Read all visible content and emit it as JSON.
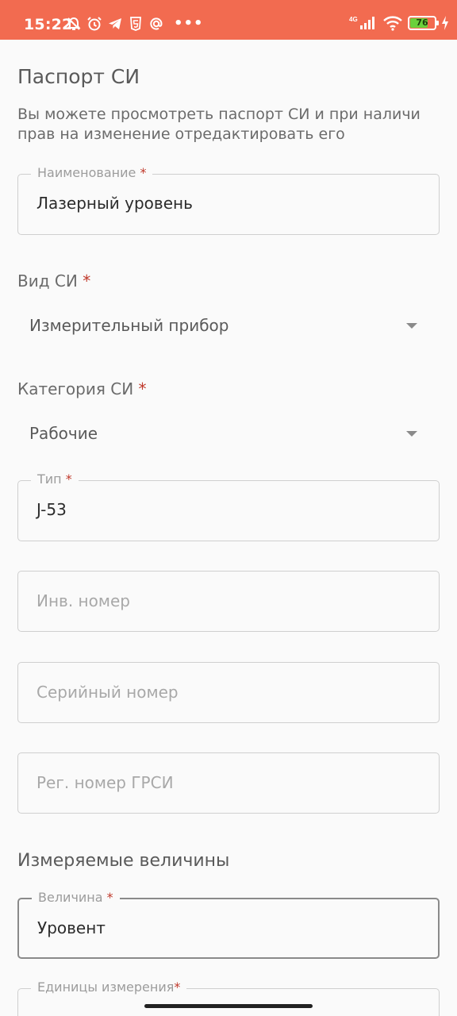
{
  "status_bar": {
    "time": "15:22",
    "network": "4G",
    "battery_level": 76,
    "battery_text": "76",
    "dots": "•••"
  },
  "header": {
    "title": "Паспорт СИ",
    "description": "Вы можете просмотреть паспорт СИ и при наличи прав на изменение отредактировать его"
  },
  "fields": {
    "name": {
      "label": "Наименование",
      "required_mark": "*",
      "value": "Лазерный уровень"
    },
    "vid": {
      "label": "Вид СИ",
      "required_mark": "*",
      "value": "Измерительный прибор"
    },
    "category": {
      "label": "Категория СИ",
      "required_mark": "*",
      "value": "Рабочие"
    },
    "type": {
      "label": "Тип",
      "required_mark": "*",
      "value": "J-53"
    },
    "inv_number": {
      "placeholder": "Инв. номер"
    },
    "serial_number": {
      "placeholder": "Серийный номер"
    },
    "reg_number": {
      "placeholder": "Рег. номер ГРСИ"
    }
  },
  "measured": {
    "title": "Измеряемые величины",
    "quantity": {
      "label": "Величина",
      "required_mark": "*",
      "value": "Уровент"
    },
    "units": {
      "label": "Единицы измерения",
      "required_mark": "*"
    }
  },
  "colors": {
    "status_bar": "#f26b50",
    "required": "#c0392b",
    "battery": "#6ad13b"
  }
}
